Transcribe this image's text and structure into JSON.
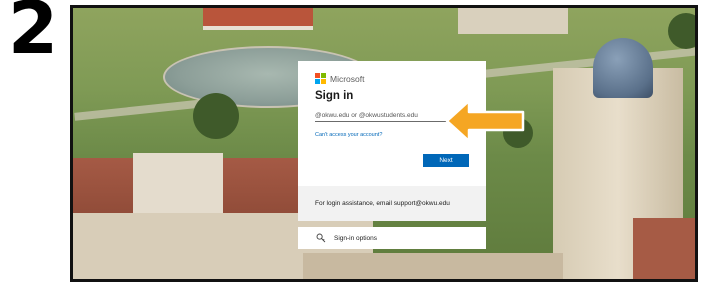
{
  "step": {
    "number": "2"
  },
  "signin": {
    "brand": "Microsoft",
    "title": "Sign in",
    "email_placeholder": "@okwu.edu or @okwustudents.edu",
    "cant_access": "Can't access your account?",
    "next_label": "Next",
    "assistance": "For login assistance, email support@okwu.edu",
    "options_label": "Sign-in options"
  },
  "icons": {
    "microsoft_logo": "microsoft-logo-icon",
    "signin_options": "key-search-icon",
    "pointer": "arrow-left-icon"
  },
  "colors": {
    "primary_button": "#0067b8",
    "link": "#0067b8",
    "arrow": "#f5a623",
    "ms_red": "#f25022",
    "ms_green": "#7fba00",
    "ms_blue": "#00a4ef",
    "ms_yellow": "#ffb900"
  }
}
